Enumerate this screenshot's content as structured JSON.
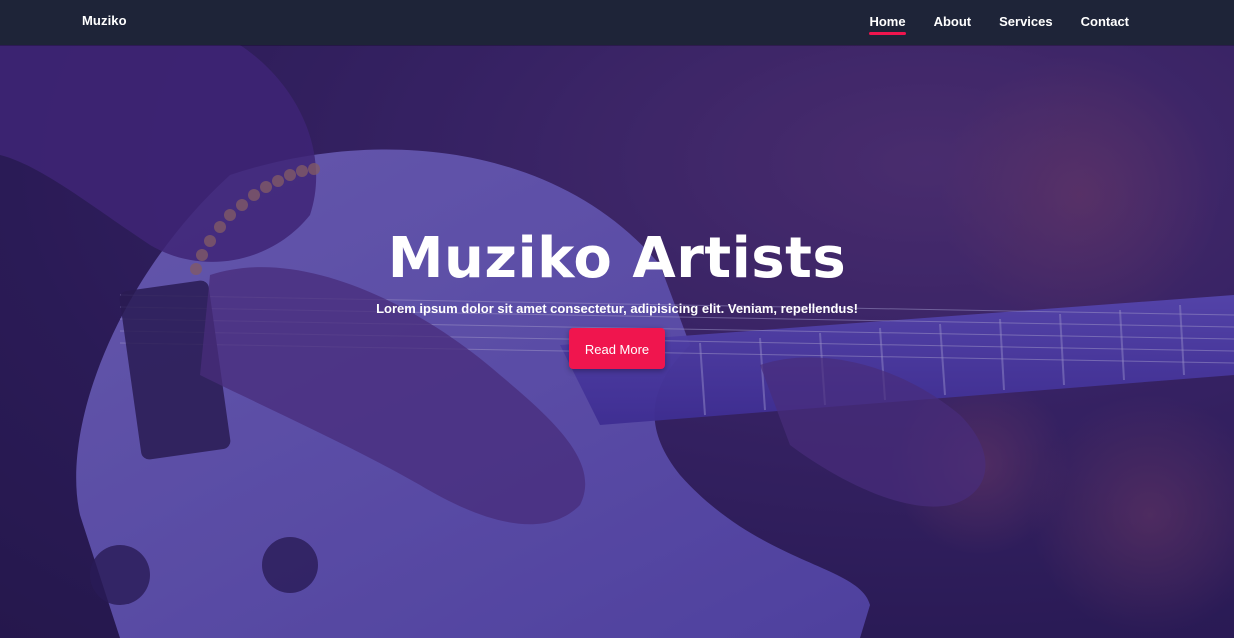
{
  "navbar": {
    "brand": "Muziko",
    "links": [
      {
        "label": "Home",
        "active": true
      },
      {
        "label": "About",
        "active": false
      },
      {
        "label": "Services",
        "active": false
      },
      {
        "label": "Contact",
        "active": false
      }
    ]
  },
  "hero": {
    "title": "Muziko Artists",
    "text": "Lorem ipsum dolor sit amet consectetur, adipisicing elit. Veniam, repellendus!",
    "button_label": "Read More"
  },
  "colors": {
    "accent": "#f0154e",
    "navbar_bg": "#1e2438",
    "overlay": "#3b2a8a"
  }
}
